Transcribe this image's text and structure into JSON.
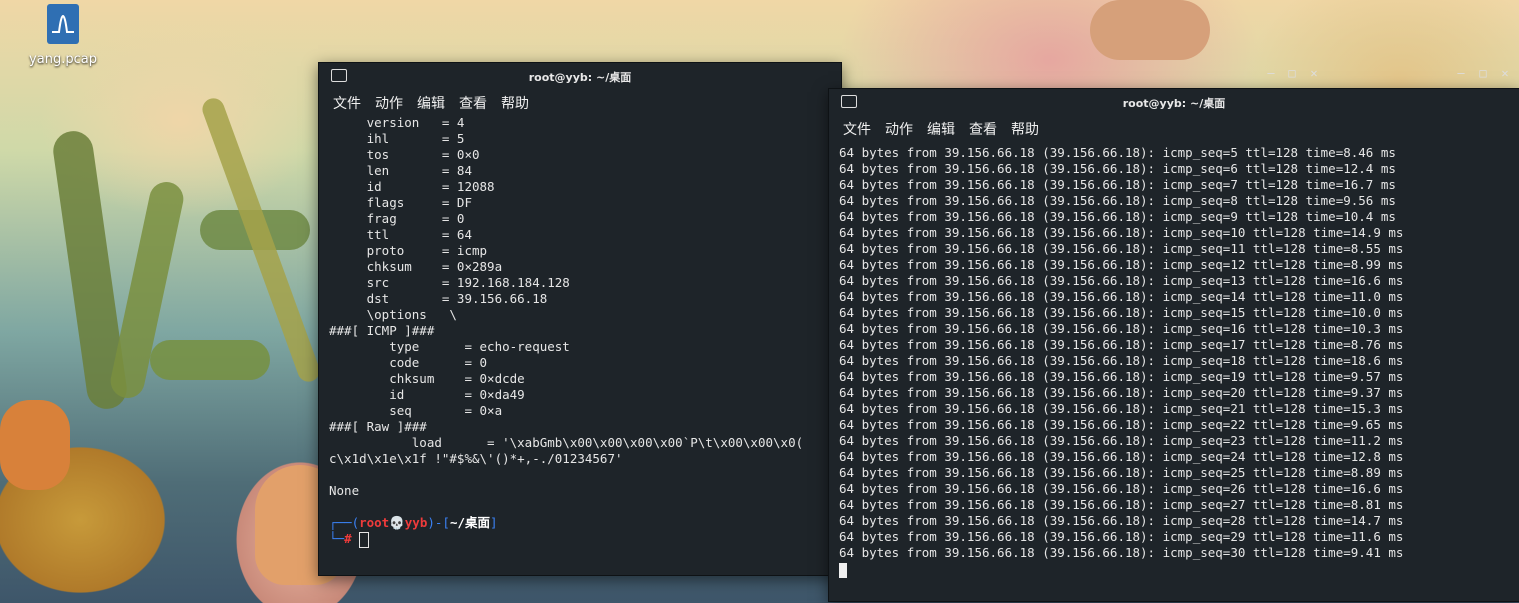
{
  "desktop": {
    "icon_label": "yang.pcap",
    "icon_name": "wireshark-file-icon"
  },
  "left_window": {
    "title": "root@yyb: ~/桌面",
    "menu": [
      "文件",
      "动作",
      "编辑",
      "查看",
      "帮助"
    ],
    "lines": [
      "     version   = 4",
      "     ihl       = 5",
      "     tos       = 0×0",
      "     len       = 84",
      "     id        = 12088",
      "     flags     = DF",
      "     frag      = 0",
      "     ttl       = 64",
      "     proto     = icmp",
      "     chksum    = 0×289a",
      "     src       = 192.168.184.128",
      "     dst       = 39.156.66.18",
      "     \\options   \\",
      "###[ ICMP ]###",
      "        type      = echo-request",
      "        code      = 0",
      "        chksum    = 0×dcde",
      "        id        = 0×da49",
      "        seq       = 0×a",
      "###[ Raw ]###",
      "           load      = '\\xabGmb\\x00\\x00\\x00\\x00`P\\t\\x00\\x00\\x0(",
      "c\\x1d\\x1e\\x1f !\"#$%&\\'()*+,-./01234567'",
      "",
      "None",
      ""
    ],
    "prompt": {
      "open": "┌──(",
      "user": "root💀yyb",
      "mid": ")-[",
      "path": "~/桌面",
      "close": "]",
      "line2": "└─",
      "hash": "#"
    }
  },
  "right_window": {
    "title": "root@yyb: ~/桌面",
    "menu": [
      "文件",
      "动作",
      "编辑",
      "查看",
      "帮助"
    ],
    "lines": [
      "64 bytes from 39.156.66.18 (39.156.66.18): icmp_seq=5 ttl=128 time=8.46 ms",
      "64 bytes from 39.156.66.18 (39.156.66.18): icmp_seq=6 ttl=128 time=12.4 ms",
      "64 bytes from 39.156.66.18 (39.156.66.18): icmp_seq=7 ttl=128 time=16.7 ms",
      "64 bytes from 39.156.66.18 (39.156.66.18): icmp_seq=8 ttl=128 time=9.56 ms",
      "64 bytes from 39.156.66.18 (39.156.66.18): icmp_seq=9 ttl=128 time=10.4 ms",
      "64 bytes from 39.156.66.18 (39.156.66.18): icmp_seq=10 ttl=128 time=14.9 ms",
      "64 bytes from 39.156.66.18 (39.156.66.18): icmp_seq=11 ttl=128 time=8.55 ms",
      "64 bytes from 39.156.66.18 (39.156.66.18): icmp_seq=12 ttl=128 time=8.99 ms",
      "64 bytes from 39.156.66.18 (39.156.66.18): icmp_seq=13 ttl=128 time=16.6 ms",
      "64 bytes from 39.156.66.18 (39.156.66.18): icmp_seq=14 ttl=128 time=11.0 ms",
      "64 bytes from 39.156.66.18 (39.156.66.18): icmp_seq=15 ttl=128 time=10.0 ms",
      "64 bytes from 39.156.66.18 (39.156.66.18): icmp_seq=16 ttl=128 time=10.3 ms",
      "64 bytes from 39.156.66.18 (39.156.66.18): icmp_seq=17 ttl=128 time=8.76 ms",
      "64 bytes from 39.156.66.18 (39.156.66.18): icmp_seq=18 ttl=128 time=18.6 ms",
      "64 bytes from 39.156.66.18 (39.156.66.18): icmp_seq=19 ttl=128 time=9.57 ms",
      "64 bytes from 39.156.66.18 (39.156.66.18): icmp_seq=20 ttl=128 time=9.37 ms",
      "64 bytes from 39.156.66.18 (39.156.66.18): icmp_seq=21 ttl=128 time=15.3 ms",
      "64 bytes from 39.156.66.18 (39.156.66.18): icmp_seq=22 ttl=128 time=9.65 ms",
      "64 bytes from 39.156.66.18 (39.156.66.18): icmp_seq=23 ttl=128 time=11.2 ms",
      "64 bytes from 39.156.66.18 (39.156.66.18): icmp_seq=24 ttl=128 time=12.8 ms",
      "64 bytes from 39.156.66.18 (39.156.66.18): icmp_seq=25 ttl=128 time=8.89 ms",
      "64 bytes from 39.156.66.18 (39.156.66.18): icmp_seq=26 ttl=128 time=16.6 ms",
      "64 bytes from 39.156.66.18 (39.156.66.18): icmp_seq=27 ttl=128 time=8.81 ms",
      "64 bytes from 39.156.66.18 (39.156.66.18): icmp_seq=28 ttl=128 time=14.7 ms",
      "64 bytes from 39.156.66.18 (39.156.66.18): icmp_seq=29 ttl=128 time=11.6 ms",
      "64 bytes from 39.156.66.18 (39.156.66.18): icmp_seq=30 ttl=128 time=9.41 ms"
    ]
  },
  "window_controls": {
    "minimize": "–",
    "maximize": "□",
    "close": "✕"
  },
  "colors": {
    "terminal_bg": "#1e2429",
    "prompt_blue": "#3b82f6",
    "prompt_red": "#ef3b3b"
  }
}
